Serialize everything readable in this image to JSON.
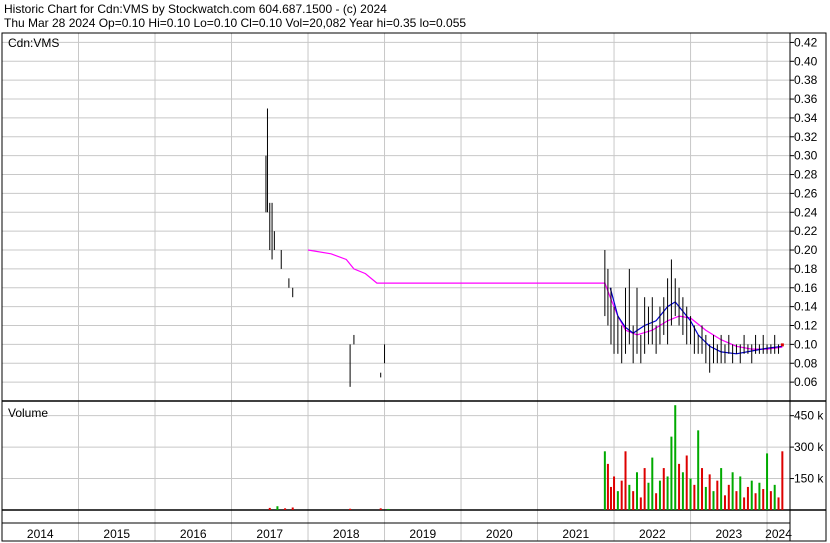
{
  "header": {
    "line1": "Historic Chart for Cdn:VMS by Stockwatch.com 604.687.1500 - (c) 2024",
    "line2": "Thu Mar 28 2024  Op=0.10  Hi=0.10  Lo=0.10  Cl=0.10  Vol=20,082  Year hi=0.35  lo=0.055"
  },
  "colors": {
    "price": "#000000",
    "ma_short": "#0000cc",
    "ma_long": "#ff00ff",
    "vol_up": "#00aa00",
    "vol_down": "#dd0000",
    "grid": "#c8c8c8",
    "frame": "#000000"
  },
  "chart_data": [
    {
      "type": "line",
      "title": "Cdn:VMS",
      "y_ticks": [
        "0.42",
        "0.40",
        "0.38",
        "0.36",
        "0.34",
        "0.32",
        "0.30",
        "0.28",
        "0.26",
        "0.24",
        "0.22",
        "0.20",
        "0.18",
        "0.16",
        "0.14",
        "0.12",
        "0.10",
        "0.08",
        "0.06"
      ],
      "ylim": [
        0.04,
        0.43
      ],
      "x_years": [
        "2014",
        "2015",
        "2016",
        "2017",
        "2018",
        "2019",
        "2020",
        "2021",
        "2022",
        "2023",
        "2024"
      ],
      "xlim": [
        2014.0,
        2024.3
      ],
      "price_bars": [
        {
          "x": 2017.45,
          "lo": 0.24,
          "hi": 0.3
        },
        {
          "x": 2017.47,
          "lo": 0.24,
          "hi": 0.35
        },
        {
          "x": 2017.5,
          "lo": 0.2,
          "hi": 0.25
        },
        {
          "x": 2017.53,
          "lo": 0.19,
          "hi": 0.25
        },
        {
          "x": 2017.56,
          "lo": 0.2,
          "hi": 0.22
        },
        {
          "x": 2017.65,
          "lo": 0.18,
          "hi": 0.2
        },
        {
          "x": 2017.75,
          "lo": 0.16,
          "hi": 0.17
        },
        {
          "x": 2017.8,
          "lo": 0.15,
          "hi": 0.16
        },
        {
          "x": 2018.55,
          "lo": 0.055,
          "hi": 0.1
        },
        {
          "x": 2018.6,
          "lo": 0.1,
          "hi": 0.11
        },
        {
          "x": 2018.95,
          "lo": 0.065,
          "hi": 0.07
        },
        {
          "x": 2019.0,
          "lo": 0.08,
          "hi": 0.1
        },
        {
          "x": 2021.88,
          "lo": 0.13,
          "hi": 0.2
        },
        {
          "x": 2021.92,
          "lo": 0.12,
          "hi": 0.18
        },
        {
          "x": 2021.96,
          "lo": 0.1,
          "hi": 0.16
        },
        {
          "x": 2022.0,
          "lo": 0.09,
          "hi": 0.14
        },
        {
          "x": 2022.05,
          "lo": 0.09,
          "hi": 0.13
        },
        {
          "x": 2022.1,
          "lo": 0.08,
          "hi": 0.12
        },
        {
          "x": 2022.15,
          "lo": 0.09,
          "hi": 0.16
        },
        {
          "x": 2022.2,
          "lo": 0.1,
          "hi": 0.18
        },
        {
          "x": 2022.25,
          "lo": 0.08,
          "hi": 0.12
        },
        {
          "x": 2022.3,
          "lo": 0.09,
          "hi": 0.16
        },
        {
          "x": 2022.35,
          "lo": 0.08,
          "hi": 0.11
        },
        {
          "x": 2022.4,
          "lo": 0.09,
          "hi": 0.15
        },
        {
          "x": 2022.45,
          "lo": 0.1,
          "hi": 0.14
        },
        {
          "x": 2022.5,
          "lo": 0.1,
          "hi": 0.15
        },
        {
          "x": 2022.55,
          "lo": 0.09,
          "hi": 0.12
        },
        {
          "x": 2022.6,
          "lo": 0.1,
          "hi": 0.14
        },
        {
          "x": 2022.65,
          "lo": 0.11,
          "hi": 0.15
        },
        {
          "x": 2022.7,
          "lo": 0.1,
          "hi": 0.17
        },
        {
          "x": 2022.75,
          "lo": 0.12,
          "hi": 0.19
        },
        {
          "x": 2022.8,
          "lo": 0.13,
          "hi": 0.17
        },
        {
          "x": 2022.85,
          "lo": 0.12,
          "hi": 0.16
        },
        {
          "x": 2022.9,
          "lo": 0.11,
          "hi": 0.15
        },
        {
          "x": 2022.95,
          "lo": 0.1,
          "hi": 0.14
        },
        {
          "x": 2023.0,
          "lo": 0.1,
          "hi": 0.13
        },
        {
          "x": 2023.05,
          "lo": 0.09,
          "hi": 0.12
        },
        {
          "x": 2023.1,
          "lo": 0.09,
          "hi": 0.11
        },
        {
          "x": 2023.15,
          "lo": 0.09,
          "hi": 0.12
        },
        {
          "x": 2023.2,
          "lo": 0.08,
          "hi": 0.11
        },
        {
          "x": 2023.25,
          "lo": 0.07,
          "hi": 0.1
        },
        {
          "x": 2023.3,
          "lo": 0.08,
          "hi": 0.11
        },
        {
          "x": 2023.35,
          "lo": 0.08,
          "hi": 0.1
        },
        {
          "x": 2023.4,
          "lo": 0.08,
          "hi": 0.11
        },
        {
          "x": 2023.45,
          "lo": 0.08,
          "hi": 0.1
        },
        {
          "x": 2023.5,
          "lo": 0.09,
          "hi": 0.11
        },
        {
          "x": 2023.55,
          "lo": 0.08,
          "hi": 0.1
        },
        {
          "x": 2023.6,
          "lo": 0.09,
          "hi": 0.1
        },
        {
          "x": 2023.65,
          "lo": 0.08,
          "hi": 0.1
        },
        {
          "x": 2023.7,
          "lo": 0.09,
          "hi": 0.11
        },
        {
          "x": 2023.75,
          "lo": 0.09,
          "hi": 0.1
        },
        {
          "x": 2023.8,
          "lo": 0.08,
          "hi": 0.1
        },
        {
          "x": 2023.85,
          "lo": 0.09,
          "hi": 0.11
        },
        {
          "x": 2023.9,
          "lo": 0.09,
          "hi": 0.1
        },
        {
          "x": 2023.95,
          "lo": 0.09,
          "hi": 0.11
        },
        {
          "x": 2024.0,
          "lo": 0.09,
          "hi": 0.1
        },
        {
          "x": 2024.05,
          "lo": 0.09,
          "hi": 0.1
        },
        {
          "x": 2024.1,
          "lo": 0.09,
          "hi": 0.11
        },
        {
          "x": 2024.15,
          "lo": 0.09,
          "hi": 0.1
        },
        {
          "x": 2024.2,
          "lo": 0.1,
          "hi": 0.1
        }
      ],
      "ma_long": [
        {
          "x": 2018.0,
          "y": 0.2
        },
        {
          "x": 2018.3,
          "y": 0.196
        },
        {
          "x": 2018.5,
          "y": 0.19
        },
        {
          "x": 2018.6,
          "y": 0.18
        },
        {
          "x": 2018.75,
          "y": 0.175
        },
        {
          "x": 2018.9,
          "y": 0.165
        },
        {
          "x": 2021.88,
          "y": 0.165
        },
        {
          "x": 2021.95,
          "y": 0.15
        },
        {
          "x": 2022.05,
          "y": 0.13
        },
        {
          "x": 2022.15,
          "y": 0.115
        },
        {
          "x": 2022.3,
          "y": 0.11
        },
        {
          "x": 2022.5,
          "y": 0.115
        },
        {
          "x": 2022.7,
          "y": 0.125
        },
        {
          "x": 2022.85,
          "y": 0.13
        },
        {
          "x": 2023.0,
          "y": 0.128
        },
        {
          "x": 2023.2,
          "y": 0.115
        },
        {
          "x": 2023.4,
          "y": 0.105
        },
        {
          "x": 2023.6,
          "y": 0.098
        },
        {
          "x": 2023.8,
          "y": 0.095
        },
        {
          "x": 2024.0,
          "y": 0.095
        },
        {
          "x": 2024.2,
          "y": 0.097
        }
      ],
      "ma_short": [
        {
          "x": 2021.95,
          "y": 0.16
        },
        {
          "x": 2022.05,
          "y": 0.13
        },
        {
          "x": 2022.15,
          "y": 0.118
        },
        {
          "x": 2022.25,
          "y": 0.112
        },
        {
          "x": 2022.4,
          "y": 0.12
        },
        {
          "x": 2022.55,
          "y": 0.125
        },
        {
          "x": 2022.7,
          "y": 0.14
        },
        {
          "x": 2022.8,
          "y": 0.145
        },
        {
          "x": 2022.9,
          "y": 0.135
        },
        {
          "x": 2023.0,
          "y": 0.125
        },
        {
          "x": 2023.1,
          "y": 0.11
        },
        {
          "x": 2023.25,
          "y": 0.098
        },
        {
          "x": 2023.4,
          "y": 0.092
        },
        {
          "x": 2023.6,
          "y": 0.09
        },
        {
          "x": 2023.8,
          "y": 0.093
        },
        {
          "x": 2024.0,
          "y": 0.096
        },
        {
          "x": 2024.2,
          "y": 0.098
        }
      ]
    },
    {
      "type": "bar",
      "title": "Volume",
      "y_ticks": [
        "450 k",
        "300 k",
        "150 k"
      ],
      "ylim": [
        0,
        520
      ],
      "bars": [
        {
          "x": 2017.5,
          "v": 10,
          "up": false
        },
        {
          "x": 2017.6,
          "v": 18,
          "up": true
        },
        {
          "x": 2017.7,
          "v": 8,
          "up": false
        },
        {
          "x": 2017.8,
          "v": 12,
          "up": false
        },
        {
          "x": 2018.55,
          "v": 6,
          "up": false
        },
        {
          "x": 2018.95,
          "v": 8,
          "up": false
        },
        {
          "x": 2019.05,
          "v": 5,
          "up": true
        },
        {
          "x": 2021.88,
          "v": 280,
          "up": true
        },
        {
          "x": 2021.92,
          "v": 220,
          "up": false
        },
        {
          "x": 2021.96,
          "v": 110,
          "up": false
        },
        {
          "x": 2022.0,
          "v": 160,
          "up": false
        },
        {
          "x": 2022.05,
          "v": 90,
          "up": true
        },
        {
          "x": 2022.1,
          "v": 140,
          "up": false
        },
        {
          "x": 2022.15,
          "v": 280,
          "up": false
        },
        {
          "x": 2022.2,
          "v": 120,
          "up": true
        },
        {
          "x": 2022.25,
          "v": 90,
          "up": false
        },
        {
          "x": 2022.3,
          "v": 180,
          "up": true
        },
        {
          "x": 2022.35,
          "v": 60,
          "up": false
        },
        {
          "x": 2022.4,
          "v": 200,
          "up": false
        },
        {
          "x": 2022.45,
          "v": 130,
          "up": true
        },
        {
          "x": 2022.5,
          "v": 250,
          "up": true
        },
        {
          "x": 2022.55,
          "v": 80,
          "up": false
        },
        {
          "x": 2022.6,
          "v": 140,
          "up": true
        },
        {
          "x": 2022.65,
          "v": 200,
          "up": false
        },
        {
          "x": 2022.7,
          "v": 160,
          "up": true
        },
        {
          "x": 2022.75,
          "v": 350,
          "up": true
        },
        {
          "x": 2022.8,
          "v": 500,
          "up": true
        },
        {
          "x": 2022.85,
          "v": 220,
          "up": false
        },
        {
          "x": 2022.9,
          "v": 180,
          "up": true
        },
        {
          "x": 2022.95,
          "v": 260,
          "up": false
        },
        {
          "x": 2023.0,
          "v": 150,
          "up": true
        },
        {
          "x": 2023.05,
          "v": 120,
          "up": false
        },
        {
          "x": 2023.1,
          "v": 380,
          "up": true
        },
        {
          "x": 2023.15,
          "v": 200,
          "up": false
        },
        {
          "x": 2023.2,
          "v": 110,
          "up": true
        },
        {
          "x": 2023.25,
          "v": 170,
          "up": false
        },
        {
          "x": 2023.3,
          "v": 90,
          "up": true
        },
        {
          "x": 2023.35,
          "v": 140,
          "up": false
        },
        {
          "x": 2023.4,
          "v": 200,
          "up": true
        },
        {
          "x": 2023.45,
          "v": 70,
          "up": false
        },
        {
          "x": 2023.5,
          "v": 120,
          "up": false
        },
        {
          "x": 2023.55,
          "v": 180,
          "up": true
        },
        {
          "x": 2023.6,
          "v": 90,
          "up": false
        },
        {
          "x": 2023.65,
          "v": 160,
          "up": true
        },
        {
          "x": 2023.7,
          "v": 60,
          "up": false
        },
        {
          "x": 2023.75,
          "v": 110,
          "up": false
        },
        {
          "x": 2023.8,
          "v": 140,
          "up": true
        },
        {
          "x": 2023.85,
          "v": 80,
          "up": false
        },
        {
          "x": 2023.9,
          "v": 130,
          "up": true
        },
        {
          "x": 2023.95,
          "v": 100,
          "up": false
        },
        {
          "x": 2024.0,
          "v": 270,
          "up": true
        },
        {
          "x": 2024.05,
          "v": 90,
          "up": false
        },
        {
          "x": 2024.1,
          "v": 120,
          "up": true
        },
        {
          "x": 2024.15,
          "v": 60,
          "up": false
        },
        {
          "x": 2024.2,
          "v": 280,
          "up": false
        }
      ]
    }
  ]
}
